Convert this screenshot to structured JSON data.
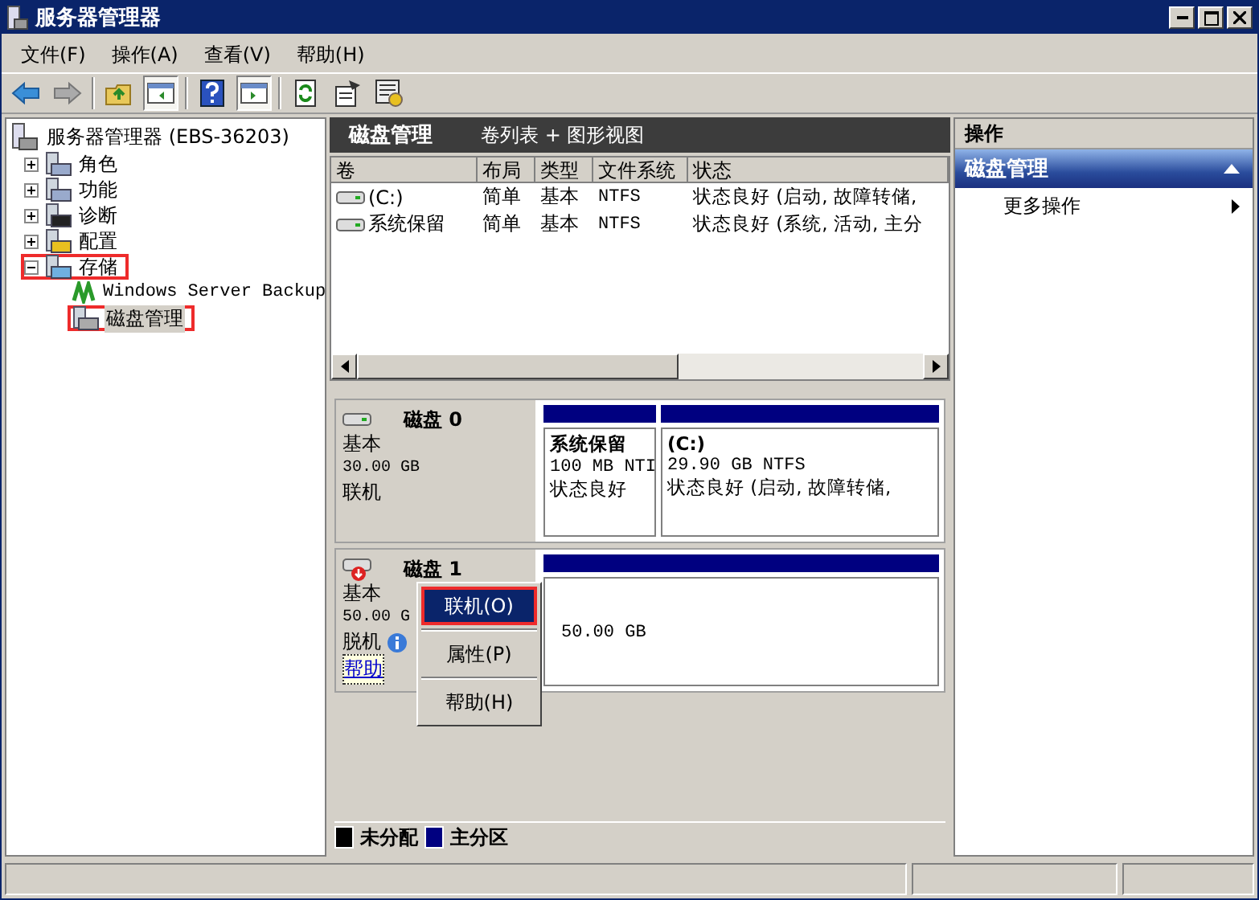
{
  "window": {
    "title": "服务器管理器"
  },
  "menu": [
    "文件(F)",
    "操作(A)",
    "查看(V)",
    "帮助(H)"
  ],
  "toolbar": [
    {
      "kind": "back",
      "pressed": false
    },
    {
      "kind": "forward",
      "pressed": false
    },
    {
      "kind": "sep"
    },
    {
      "kind": "up",
      "pressed": false
    },
    {
      "kind": "pane",
      "pressed": true
    },
    {
      "kind": "sep"
    },
    {
      "kind": "help",
      "pressed": false
    },
    {
      "kind": "pane2",
      "pressed": true
    },
    {
      "kind": "sep"
    },
    {
      "kind": "refresh",
      "pressed": false
    },
    {
      "kind": "props",
      "pressed": false
    },
    {
      "kind": "settings",
      "pressed": false
    }
  ],
  "tree": {
    "label": "服务器管理器 (EBS-36203)",
    "children": [
      {
        "label": "角色",
        "kind": "roles",
        "expanded": false,
        "selected": false,
        "highlighted": false
      },
      {
        "label": "功能",
        "kind": "features",
        "expanded": false,
        "selected": false,
        "highlighted": false
      },
      {
        "label": "诊断",
        "kind": "diag",
        "expanded": false,
        "selected": false,
        "highlighted": false
      },
      {
        "label": "配置",
        "kind": "config",
        "expanded": false,
        "selected": false,
        "highlighted": false
      },
      {
        "label": "存储",
        "kind": "storage",
        "expanded": true,
        "selected": false,
        "highlighted": true,
        "children": [
          {
            "label": "Windows Server Backup",
            "kind": "backup",
            "selected": false,
            "highlighted": false
          },
          {
            "label": "磁盘管理",
            "kind": "disk",
            "selected": true,
            "highlighted": true
          }
        ]
      }
    ]
  },
  "center": {
    "title": "磁盘管理",
    "subtitle": "卷列表 + 图形视图"
  },
  "table": {
    "columns": [
      "卷",
      "布局",
      "类型",
      "文件系统",
      "状态"
    ],
    "rows": [
      [
        "(C:)",
        "简单",
        "基本",
        "NTFS",
        "状态良好 (启动, 故障转储,"
      ],
      [
        "系统保留",
        "简单",
        "基本",
        "NTFS",
        "状态良好 (系统, 活动, 主分"
      ]
    ]
  },
  "disks": [
    {
      "name": "磁盘 0",
      "type": "基本",
      "size": "30.00 GB",
      "status": "联机",
      "online": true,
      "partitions": [
        {
          "name": "系统保留",
          "detail": "100 MB NTI",
          "status": "状态良好",
          "kind": "primary"
        },
        {
          "name": "(C:)",
          "detail": "29.90 GB NTFS",
          "status": "状态良好 (启动, 故障转储,",
          "kind": "primary"
        }
      ]
    },
    {
      "name": "磁盘 1",
      "type": "基本",
      "size": "50.00 G",
      "status": "脱机",
      "online": false,
      "help": "帮助",
      "partitions": [
        {
          "detail": "50.00 GB",
          "kind": "primary"
        }
      ]
    }
  ],
  "context_menu": [
    {
      "label": "联机(O)",
      "selected": true,
      "highlighted": true
    },
    {
      "label": "属性(P)",
      "selected": false,
      "highlighted": false
    },
    {
      "label": "帮助(H)",
      "selected": false,
      "highlighted": false
    }
  ],
  "legend": [
    {
      "label": "未分配",
      "color": "#000000"
    },
    {
      "label": "主分区",
      "color": "#000080"
    }
  ],
  "actions": {
    "title": "操作",
    "section": "磁盘管理",
    "items": [
      "更多操作"
    ]
  }
}
